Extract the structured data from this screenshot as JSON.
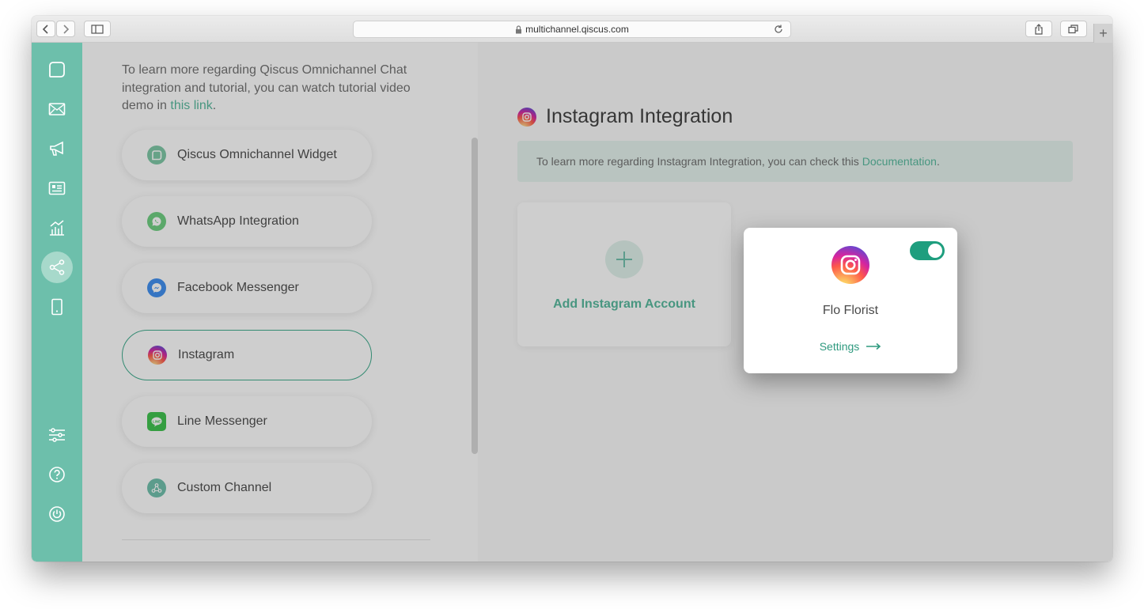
{
  "browser": {
    "url": "multichannel.qiscus.com",
    "new_tab_label": "+"
  },
  "sidebar": {
    "items": [
      {
        "name": "chat-icon",
        "active": false
      },
      {
        "name": "mail-icon",
        "active": false
      },
      {
        "name": "broadcast-icon",
        "active": false
      },
      {
        "name": "contacts-icon",
        "active": false
      },
      {
        "name": "analytics-icon",
        "active": false
      },
      {
        "name": "integration-icon",
        "active": true
      },
      {
        "name": "mobile-icon",
        "active": false
      },
      {
        "name": "settings-sliders-icon",
        "active": false
      },
      {
        "name": "help-icon",
        "active": false
      },
      {
        "name": "power-icon",
        "active": false
      }
    ]
  },
  "left": {
    "intro_text": "To learn more regarding Qiscus Omnichannel Chat integration and tutorial, you can watch tutorial video demo in ",
    "intro_link": "this link",
    "intro_end": ".",
    "channels": [
      {
        "label": "Qiscus Omnichannel Widget",
        "icon": "qiscus-icon",
        "color": "#7cc7a5",
        "active": false
      },
      {
        "label": "WhatsApp Integration",
        "icon": "whatsapp-icon",
        "color": "#6ccf7f",
        "active": false
      },
      {
        "label": "Facebook Messenger",
        "icon": "messenger-icon",
        "color": "#3d8ef0",
        "active": false
      },
      {
        "label": "Instagram",
        "icon": "instagram-icon",
        "color": "#e1306c",
        "active": true
      },
      {
        "label": "Line Messenger",
        "icon": "line-icon",
        "color": "#3bc24b",
        "active": false
      },
      {
        "label": "Custom Channel",
        "icon": "custom-channel-icon",
        "color": "#6dbfab",
        "active": false
      }
    ]
  },
  "right": {
    "title": "Instagram Integration",
    "doc_text": "To learn more regarding Instagram Integration, you can check this",
    "doc_link": "Documentation",
    "doc_end": ".",
    "add_label": "Add Instagram Account",
    "account": {
      "name": "Flo Florist",
      "settings_label": "Settings",
      "enabled": true
    }
  },
  "colors": {
    "accent": "#54b89c",
    "sidebar": "#6dbfab",
    "toggle_on": "#1e9e7e"
  }
}
